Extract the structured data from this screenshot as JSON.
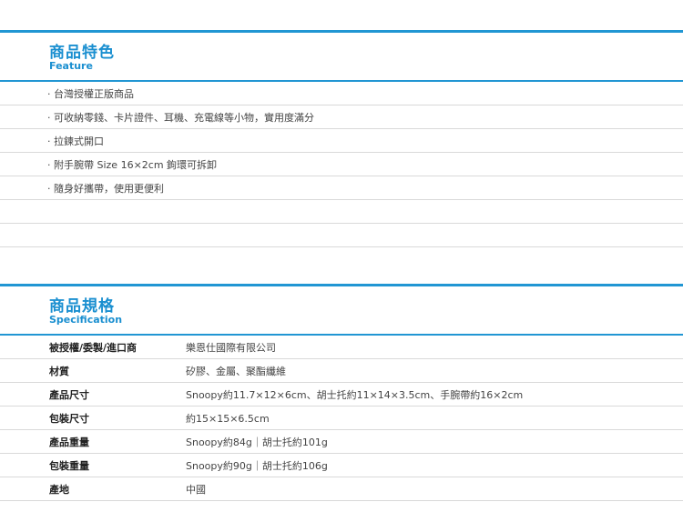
{
  "feature": {
    "title_cn": "商品特色",
    "title_en": "Feature",
    "items": [
      "· 台灣授權正版商品",
      "· 可收納零錢、卡片證件、耳機、充電線等小物，實用度滿分",
      "· 拉鍊式開口",
      "· 附手腕帶 Size 16×2cm 鉤環可拆卸",
      "· 隨身好攜帶，使用更便利",
      "",
      ""
    ]
  },
  "spec": {
    "title_cn": "商品規格",
    "title_en": "Specification",
    "rows": [
      {
        "label": "被授權/委製/進口商",
        "value": "樂恩仕國際有限公司"
      },
      {
        "label": "材質",
        "value": "矽膠、金屬、聚酯纖維"
      },
      {
        "label": "產品尺寸",
        "value": "Snoopy約11.7×12×6cm、胡士托約11×14×3.5cm、手腕帶約16×2cm"
      },
      {
        "label": "包裝尺寸",
        "value": "約15×15×6.5cm"
      },
      {
        "label": "產品重量",
        "value": "Snoopy約84g｜胡士托約101g"
      },
      {
        "label": "包裝重量",
        "value": "Snoopy約90g｜胡士托約106g"
      },
      {
        "label": "產地",
        "value": "中國"
      }
    ]
  },
  "colors": {
    "accent": "#2196d3",
    "divider": "#d9d9d9"
  }
}
